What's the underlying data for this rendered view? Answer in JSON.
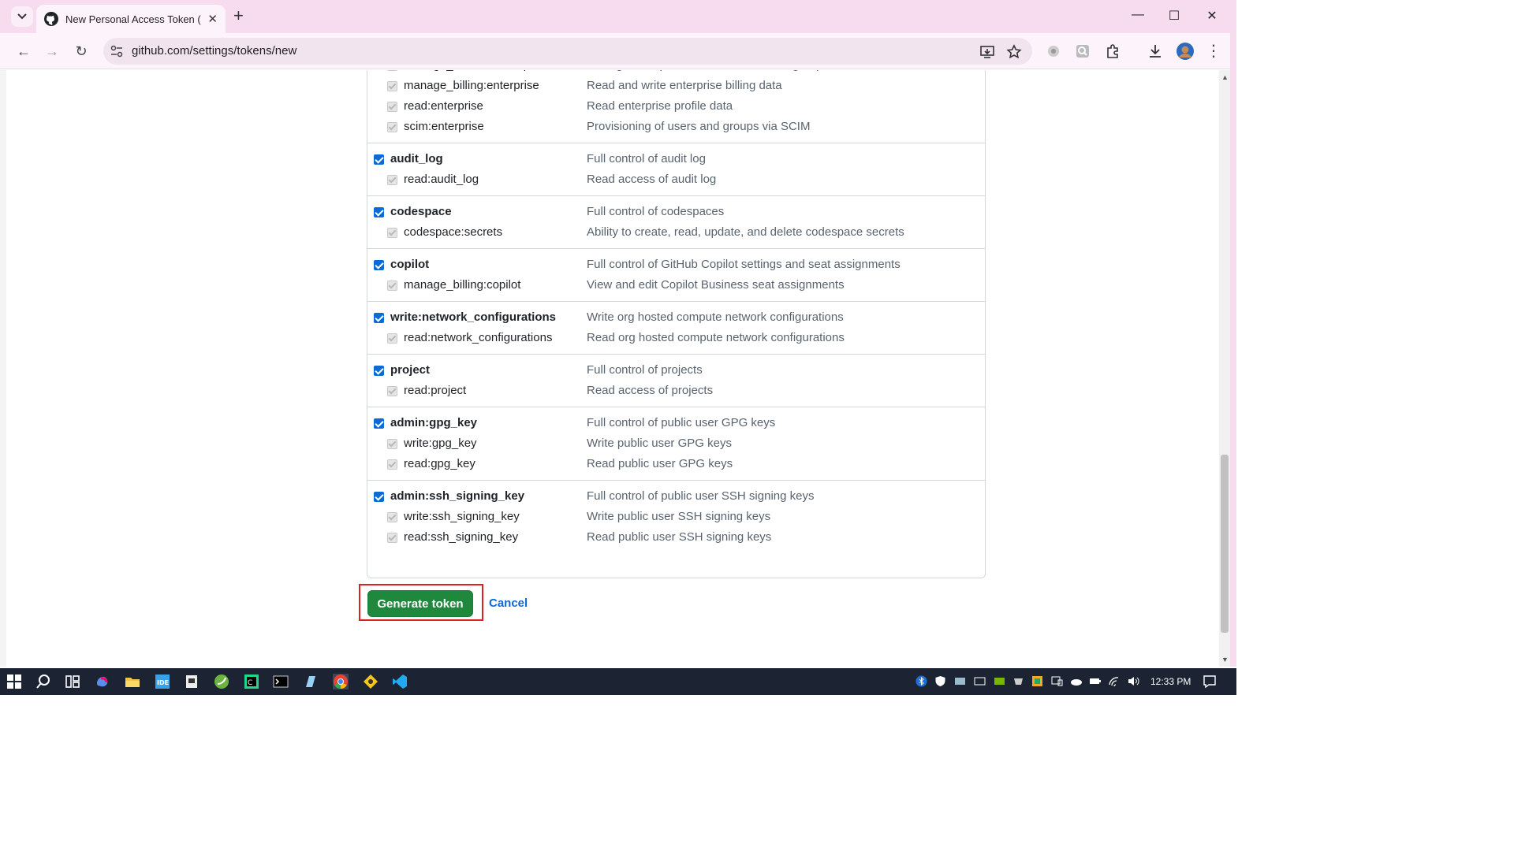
{
  "browser": {
    "tab_title": "New Personal Access Token (Cl",
    "url": "github.com/settings/tokens/new"
  },
  "scopes": [
    {
      "main": null,
      "subs": [
        {
          "name": "manage_runners:enterprise",
          "desc": "Manage enterprise runners and runner groups"
        },
        {
          "name": "manage_billing:enterprise",
          "desc": "Read and write enterprise billing data"
        },
        {
          "name": "read:enterprise",
          "desc": "Read enterprise profile data"
        },
        {
          "name": "scim:enterprise",
          "desc": "Provisioning of users and groups via SCIM"
        }
      ]
    },
    {
      "main": {
        "name": "audit_log",
        "desc": "Full control of audit log"
      },
      "subs": [
        {
          "name": "read:audit_log",
          "desc": "Read access of audit log"
        }
      ]
    },
    {
      "main": {
        "name": "codespace",
        "desc": "Full control of codespaces"
      },
      "subs": [
        {
          "name": "codespace:secrets",
          "desc": "Ability to create, read, update, and delete codespace secrets"
        }
      ]
    },
    {
      "main": {
        "name": "copilot",
        "desc": "Full control of GitHub Copilot settings and seat assignments"
      },
      "subs": [
        {
          "name": "manage_billing:copilot",
          "desc": "View and edit Copilot Business seat assignments"
        }
      ]
    },
    {
      "main": {
        "name": "write:network_configurations",
        "desc": "Write org hosted compute network configurations"
      },
      "subs": [
        {
          "name": "read:network_configurations",
          "desc": "Read org hosted compute network configurations"
        }
      ]
    },
    {
      "main": {
        "name": "project",
        "desc": "Full control of projects"
      },
      "subs": [
        {
          "name": "read:project",
          "desc": "Read access of projects"
        }
      ]
    },
    {
      "main": {
        "name": "admin:gpg_key",
        "desc": "Full control of public user GPG keys"
      },
      "subs": [
        {
          "name": "write:gpg_key",
          "desc": "Write public user GPG keys"
        },
        {
          "name": "read:gpg_key",
          "desc": "Read public user GPG keys"
        }
      ]
    },
    {
      "main": {
        "name": "admin:ssh_signing_key",
        "desc": "Full control of public user SSH signing keys"
      },
      "subs": [
        {
          "name": "write:ssh_signing_key",
          "desc": "Write public user SSH signing keys"
        },
        {
          "name": "read:ssh_signing_key",
          "desc": "Read public user SSH signing keys"
        }
      ]
    }
  ],
  "actions": {
    "generate_label": "Generate token",
    "cancel_label": "Cancel"
  },
  "taskbar": {
    "time": "12:33 PM"
  }
}
